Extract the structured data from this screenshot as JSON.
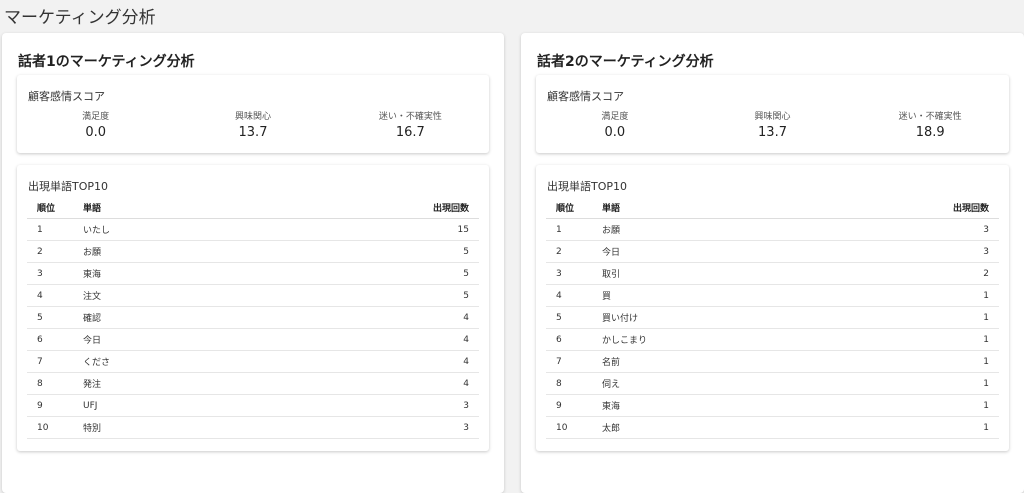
{
  "page": {
    "title": "マーケティング分析"
  },
  "speakers": [
    {
      "title": "話者1のマーケティング分析",
      "emotion": {
        "title": "顧客感情スコア",
        "metrics": [
          {
            "label": "満足度",
            "value": "0.0"
          },
          {
            "label": "興味関心",
            "value": "13.7"
          },
          {
            "label": "迷い・不確実性",
            "value": "16.7"
          }
        ]
      },
      "words": {
        "title": "出現単語TOP10",
        "headers": {
          "rank": "順位",
          "word": "単語",
          "count": "出現回数"
        },
        "rows": [
          {
            "rank": "1",
            "word": "いたし",
            "count": "15"
          },
          {
            "rank": "2",
            "word": "お願",
            "count": "5"
          },
          {
            "rank": "3",
            "word": "東海",
            "count": "5"
          },
          {
            "rank": "4",
            "word": "注文",
            "count": "5"
          },
          {
            "rank": "5",
            "word": "確認",
            "count": "4"
          },
          {
            "rank": "6",
            "word": "今日",
            "count": "4"
          },
          {
            "rank": "7",
            "word": "くださ",
            "count": "4"
          },
          {
            "rank": "8",
            "word": "発注",
            "count": "4"
          },
          {
            "rank": "9",
            "word": "UFJ",
            "count": "3"
          },
          {
            "rank": "10",
            "word": "特別",
            "count": "3"
          }
        ]
      }
    },
    {
      "title": "話者2のマーケティング分析",
      "emotion": {
        "title": "顧客感情スコア",
        "metrics": [
          {
            "label": "満足度",
            "value": "0.0"
          },
          {
            "label": "興味関心",
            "value": "13.7"
          },
          {
            "label": "迷い・不確実性",
            "value": "18.9"
          }
        ]
      },
      "words": {
        "title": "出現単語TOP10",
        "headers": {
          "rank": "順位",
          "word": "単語",
          "count": "出現回数"
        },
        "rows": [
          {
            "rank": "1",
            "word": "お願",
            "count": "3"
          },
          {
            "rank": "2",
            "word": "今日",
            "count": "3"
          },
          {
            "rank": "3",
            "word": "取引",
            "count": "2"
          },
          {
            "rank": "4",
            "word": "買",
            "count": "1"
          },
          {
            "rank": "5",
            "word": "買い付け",
            "count": "1"
          },
          {
            "rank": "6",
            "word": "かしこまり",
            "count": "1"
          },
          {
            "rank": "7",
            "word": "名前",
            "count": "1"
          },
          {
            "rank": "8",
            "word": "伺え",
            "count": "1"
          },
          {
            "rank": "9",
            "word": "東海",
            "count": "1"
          },
          {
            "rank": "10",
            "word": "太郎",
            "count": "1"
          }
        ]
      }
    }
  ]
}
